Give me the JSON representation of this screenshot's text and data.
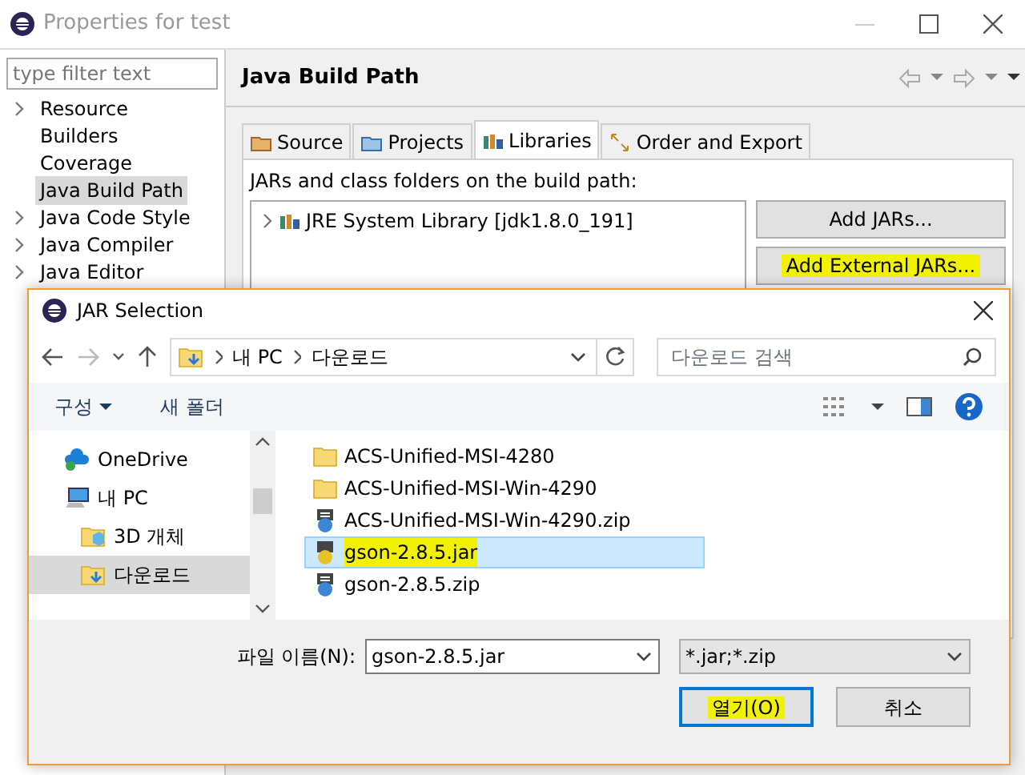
{
  "window": {
    "title": "Properties for test"
  },
  "filter": {
    "placeholder": "type filter text"
  },
  "tree": [
    {
      "label": "Resource",
      "expandable": true,
      "selected": false
    },
    {
      "label": "Builders",
      "expandable": false,
      "selected": false
    },
    {
      "label": "Coverage",
      "expandable": false,
      "selected": false
    },
    {
      "label": "Java Build Path",
      "expandable": false,
      "selected": true
    },
    {
      "label": "Java Code Style",
      "expandable": true,
      "selected": false
    },
    {
      "label": "Java Compiler",
      "expandable": true,
      "selected": false
    },
    {
      "label": "Java Editor",
      "expandable": true,
      "selected": false
    }
  ],
  "page": {
    "title": "Java Build Path"
  },
  "tabs": [
    {
      "label": "Source",
      "kind": "source",
      "selected": false
    },
    {
      "label": "Projects",
      "kind": "projects",
      "selected": false
    },
    {
      "label": "Libraries",
      "kind": "libraries",
      "selected": true
    },
    {
      "label": "Order and Export",
      "kind": "order",
      "selected": false
    }
  ],
  "libraries_caption": "JARs and class folders on the build path:",
  "libraries": [
    {
      "label": "JRE System Library [jdk1.8.0_191]",
      "expanded": false
    }
  ],
  "side_buttons": [
    {
      "label": "Add JARs...",
      "highlighted": false
    },
    {
      "label": "Add External JARs...",
      "highlighted": true
    }
  ],
  "dialog": {
    "title": "JAR Selection",
    "breadcrumb": [
      "내 PC",
      "다운로드"
    ],
    "search": {
      "placeholder": "다운로드 검색"
    },
    "commands": [
      {
        "label": "구성",
        "dropdown": true
      },
      {
        "label": "새 폴더",
        "dropdown": false
      }
    ],
    "nav": [
      {
        "label": "OneDrive",
        "kind": "cloud",
        "selected": false
      },
      {
        "label": "내 PC",
        "kind": "pc",
        "selected": false,
        "children": [
          {
            "label": "3D 개체",
            "kind": "objects3d",
            "selected": false
          },
          {
            "label": "다운로드",
            "kind": "downloads",
            "selected": true
          }
        ]
      }
    ],
    "files": [
      {
        "name": "ACS-Unified-MSI-4280",
        "kind": "folder",
        "selected": false,
        "highlighted": false
      },
      {
        "name": "ACS-Unified-MSI-Win-4290",
        "kind": "folder",
        "selected": false,
        "highlighted": false
      },
      {
        "name": "ACS-Unified-MSI-Win-4290.zip",
        "kind": "zip",
        "selected": false,
        "highlighted": false
      },
      {
        "name": "gson-2.8.5.jar",
        "kind": "jar",
        "selected": true,
        "highlighted": true
      },
      {
        "name": "gson-2.8.5.zip",
        "kind": "zip",
        "selected": false,
        "highlighted": false
      }
    ],
    "file_name_label": "파일 이름(N):",
    "file_name": "gson-2.8.5.jar",
    "file_type": "*.jar;*.zip",
    "buttons": [
      {
        "label": "열기(O)",
        "default": true,
        "highlighted": true
      },
      {
        "label": "취소",
        "default": false,
        "highlighted": false
      }
    ]
  }
}
